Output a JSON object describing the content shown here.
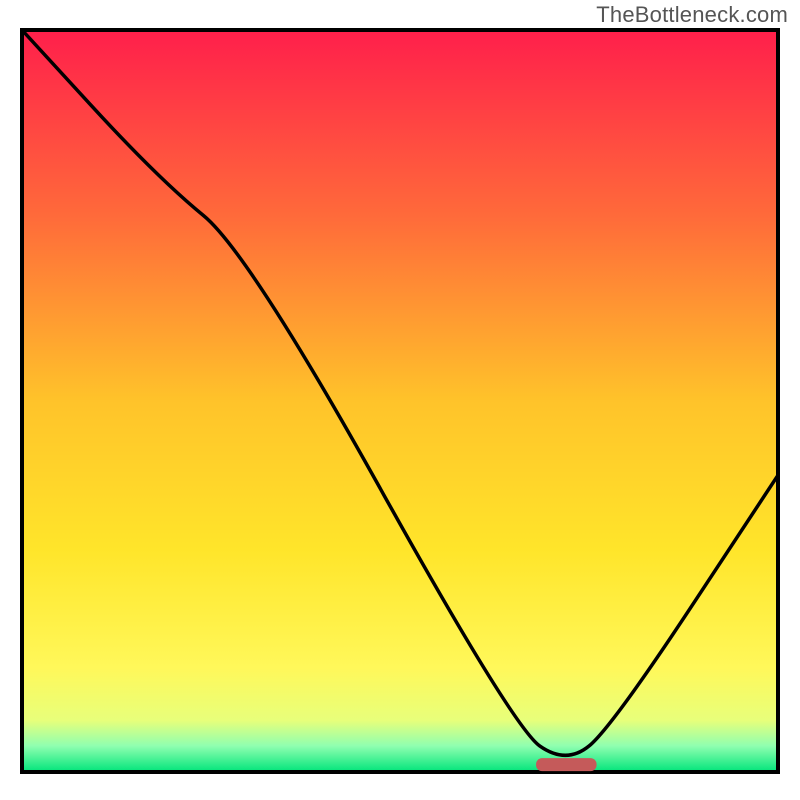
{
  "watermark": "TheBottleneck.com",
  "chart_data": {
    "type": "line",
    "title": "",
    "xlabel": "",
    "ylabel": "",
    "xlim": [
      0,
      100
    ],
    "ylim": [
      0,
      100
    ],
    "grid": false,
    "legend": false,
    "annotations": [],
    "background_gradient_stops": [
      {
        "offset": 0.0,
        "color": "#ff1f4b"
      },
      {
        "offset": 0.25,
        "color": "#ff6a3a"
      },
      {
        "offset": 0.5,
        "color": "#ffc32a"
      },
      {
        "offset": 0.7,
        "color": "#ffe52a"
      },
      {
        "offset": 0.86,
        "color": "#fff85a"
      },
      {
        "offset": 0.93,
        "color": "#e8ff7a"
      },
      {
        "offset": 0.965,
        "color": "#8fffb0"
      },
      {
        "offset": 1.0,
        "color": "#00e47a"
      }
    ],
    "series": [
      {
        "name": "bottleneck-curve",
        "stroke": "#000000",
        "x": [
          0,
          18,
          30,
          65,
          72,
          78,
          100
        ],
        "values": [
          100,
          80,
          70,
          6,
          1,
          6,
          40
        ]
      }
    ],
    "marker": {
      "name": "optimal-region",
      "shape": "rounded-bar",
      "color": "#c55a5a",
      "x_range": [
        68,
        76
      ],
      "y": 1
    }
  }
}
